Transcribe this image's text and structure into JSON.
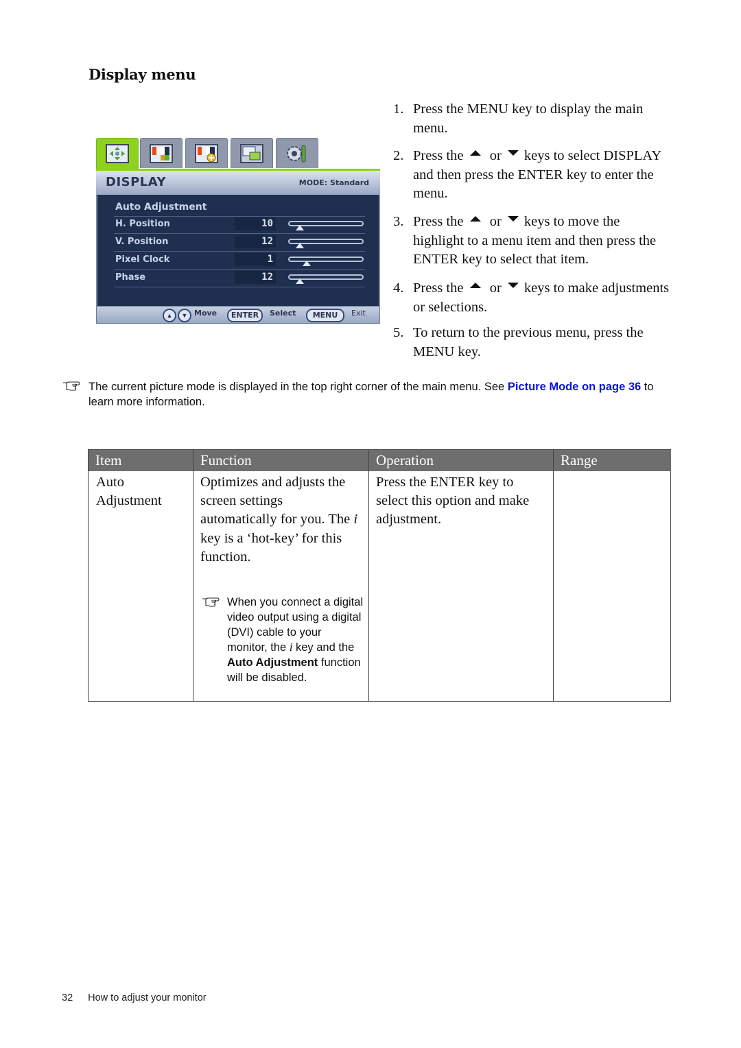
{
  "section_title": "Display menu",
  "osd": {
    "tabs": [
      {
        "icon": "display-tab-icon",
        "active": true
      },
      {
        "icon": "picture-tab-icon",
        "active": false
      },
      {
        "icon": "picture-advanced-tab-icon",
        "active": false
      },
      {
        "icon": "osd-setup-tab-icon",
        "active": false
      },
      {
        "icon": "system-settings-tab-icon",
        "active": false
      }
    ],
    "title": "DISPLAY",
    "mode_label": "MODE: Standard",
    "items": [
      {
        "label": "Auto Adjustment",
        "value": null,
        "level": null
      },
      {
        "label": "H. Position",
        "value": "10",
        "level": 0.1
      },
      {
        "label": "V. Position",
        "value": "12",
        "level": 0.1
      },
      {
        "label": "Pixel Clock",
        "value": "1",
        "level": 0.2
      },
      {
        "label": "Phase",
        "value": "12",
        "level": 0.1
      }
    ],
    "footer": {
      "up_glyph": "▲",
      "down_glyph": "▼",
      "move_label": "Move",
      "enter_key": "ENTER",
      "select_label": "Select",
      "menu_key": "MENU",
      "exit_label": "Exit"
    }
  },
  "steps": [
    {
      "num": "1.",
      "parts": [
        "Press the ",
        "MENU",
        " key to display the main menu."
      ]
    },
    {
      "num": "2.",
      "pre": "Press the ",
      "or": " or ",
      "post": "keys to select DISPLAY and then press the ENTER key to enter the menu."
    },
    {
      "num": "3.",
      "pre": "Press the ",
      "or": " or ",
      "post": "keys to move the highlight to a menu item and then press the ENTER key to select that item."
    },
    {
      "num": "4.",
      "pre": "Press the ",
      "or": " or ",
      "post": "keys to make adjustments or selections."
    },
    {
      "num": "5.",
      "text": "To return to the previous menu, press the MENU key."
    }
  ],
  "note": {
    "text_before": "The current picture mode is displayed in the top right corner of the main menu. See ",
    "link": "Picture Mode on page 36",
    "text_after": " to learn more information."
  },
  "table": {
    "headers": [
      "Item",
      "Function",
      "Operation",
      "Range"
    ],
    "rows": [
      {
        "item": "Auto Adjustment",
        "function_pre": "Optimizes and adjusts the screen settings automatically for you. The ",
        "function_key": "i",
        "function_post": " key is a ‘hot-key’ for this function.",
        "note_pre": "When you connect a digital video output using a digital (DVI) cable to your monitor, the ",
        "note_key": "i",
        "note_mid": " key and the ",
        "note_bold": "Auto Adjustment",
        "note_post": " function will be disabled.",
        "operation": "Press the ENTER key to select this option and make adjustment.",
        "range": ""
      }
    ]
  },
  "footer": {
    "page_number": "32",
    "chapter": "How to adjust your monitor"
  }
}
